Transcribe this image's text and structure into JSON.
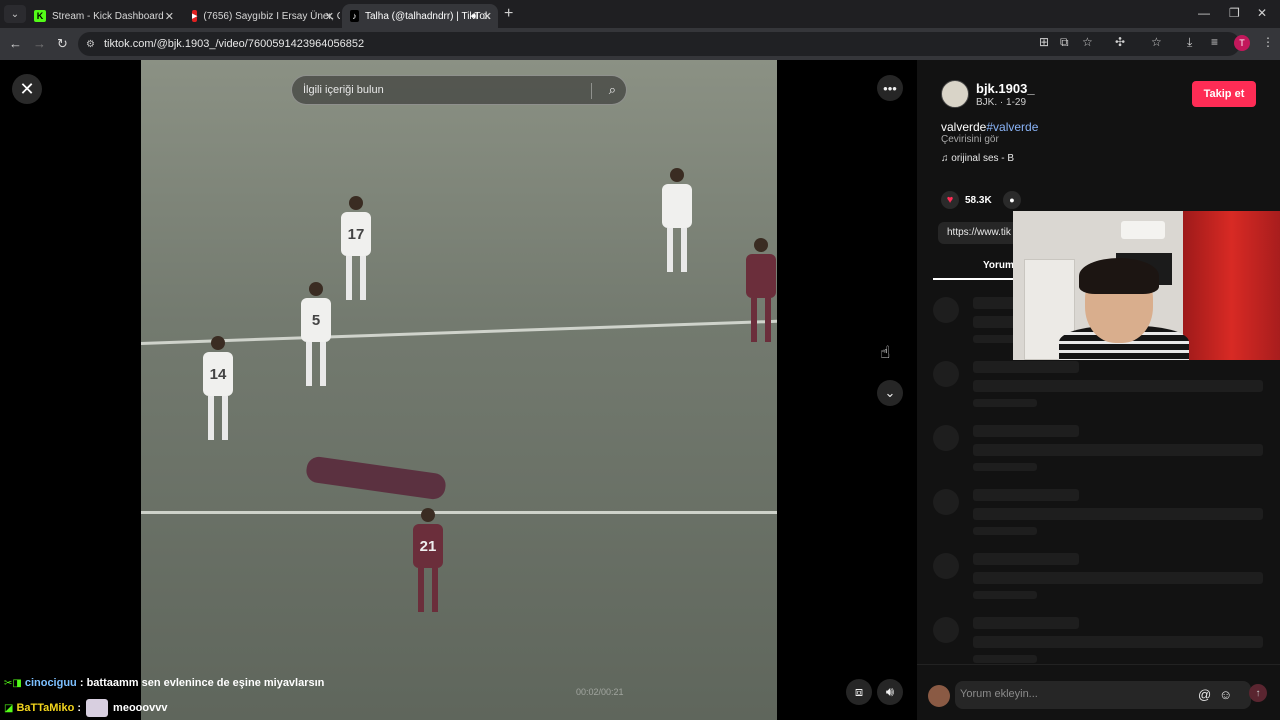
{
  "browser": {
    "tabs": [
      {
        "title": "Stream - Kick Dashboard",
        "icon": "kick-icon"
      },
      {
        "title": "(7656) Saygıbiz I Ersay Üner, Gö",
        "icon": "youtube-icon"
      },
      {
        "title": "Talha (@talhadndrr) | TikTok",
        "icon": "tiktok-icon",
        "active": true
      }
    ],
    "url": "tiktok.com/@bjk.1903_/video/7600591423964056852",
    "profile_initial": "T"
  },
  "video": {
    "search_placeholder": "İlgili içeriği bulun",
    "timestamp": "00:02/00:21",
    "jerseys": [
      "17",
      "5",
      "14",
      "21"
    ]
  },
  "post": {
    "username": "bjk.1903_",
    "subtitle": "BJK. · 1-29",
    "follow_label": "Takip et",
    "description_text": "valverde",
    "description_tag": "#valverde",
    "translate_label": "Çevirisini gör",
    "sound_label": "orijinal ses - B",
    "likes": "58.3K",
    "link_text": "https://www.tik",
    "comments_tab": "Yorumlar",
    "comment_placeholder": "Yorum ekleyin..."
  },
  "chat": [
    {
      "user": "cinociguu",
      "message": ": battaamm sen evlenince de eşine miyavlarsın"
    },
    {
      "user": "BaTTaMiko",
      "message": ":",
      "emote": true,
      "after": "meooovvv"
    }
  ],
  "colors": {
    "accent": "#fe2c55",
    "hashtag": "#8ab4f8",
    "kick_green": "#53fc18"
  }
}
